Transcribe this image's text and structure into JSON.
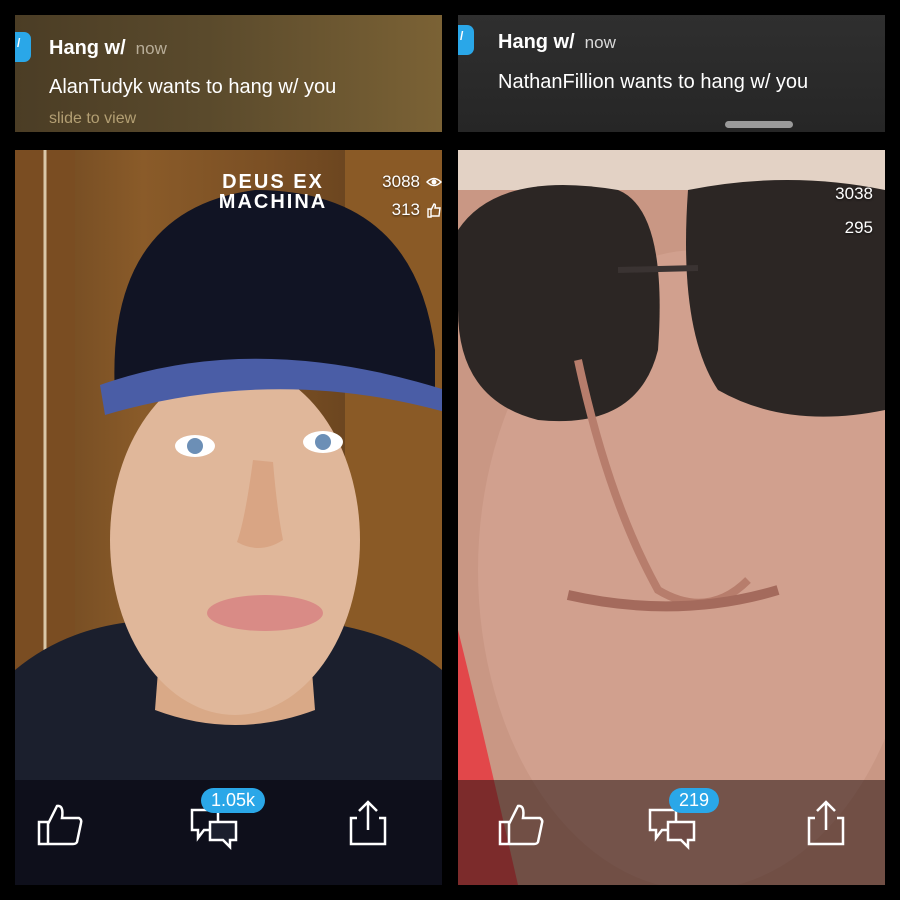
{
  "left": {
    "notification": {
      "app_name": "Hang w/",
      "time": "now",
      "message": "AlanTudyk wants to hang w/ you",
      "action": "slide to view"
    },
    "video": {
      "cap_text": "DEUS EX MACHINA",
      "viewers": "3088",
      "likes": "313",
      "comments_badge": "1.05k"
    }
  },
  "right": {
    "notification": {
      "app_name": "Hang w/",
      "time": "now",
      "message": "NathanFillion wants to hang w/ you"
    },
    "video": {
      "viewers": "3038",
      "likes": "295",
      "comments_badge": "219"
    }
  },
  "colors": {
    "accent": "#2aa7e8",
    "icons": [
      "eye-icon",
      "thumbs-up-icon",
      "comment-icon",
      "share-icon"
    ]
  }
}
